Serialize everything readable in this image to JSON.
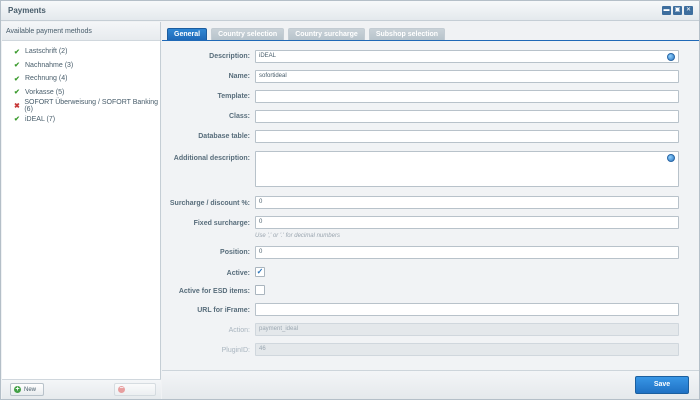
{
  "window": {
    "title": "Payments",
    "controls": [
      "minimize",
      "maximize",
      "close"
    ]
  },
  "sidebar": {
    "heading": "Available payment methods",
    "items": [
      {
        "label": "Lastschrift (2)",
        "active": true
      },
      {
        "label": "Nachnahme (3)",
        "active": true
      },
      {
        "label": "Rechnung (4)",
        "active": true
      },
      {
        "label": "Vorkasse (5)",
        "active": true
      },
      {
        "label": "SOFORT Überweisung / SOFORT Banking (6)",
        "active": false
      },
      {
        "label": "iDEAL (7)",
        "active": true
      }
    ],
    "new_label": "New",
    "delete_label": ""
  },
  "tabs": [
    {
      "label": "General",
      "active": true
    },
    {
      "label": "Country selection",
      "active": false
    },
    {
      "label": "Country surcharge",
      "active": false
    },
    {
      "label": "Subshop selection",
      "active": false
    }
  ],
  "form": {
    "description_label": "Description:",
    "description_value": "iDEAL",
    "name_label": "Name:",
    "name_value": "sofortideal",
    "template_label": "Template:",
    "template_value": "",
    "class_label": "Class:",
    "class_value": "",
    "database_table_label": "Database table:",
    "database_table_value": "",
    "additional_description_label": "Additional description:",
    "additional_description_value": "",
    "surcharge_label": "Surcharge / discount %:",
    "surcharge_value": "0",
    "fixed_surcharge_label": "Fixed surcharge:",
    "fixed_surcharge_value": "0",
    "fixed_surcharge_hint": "Use ',' or '.' for decimal numbers",
    "position_label": "Position:",
    "position_value": "0",
    "active_label": "Active:",
    "active_checked": true,
    "esd_label": "Active for ESD items:",
    "esd_checked": false,
    "iframe_label": "URL for iFrame:",
    "iframe_value": "",
    "action_label": "Action:",
    "action_value": "payment_ideal",
    "plugin_id_label": "PluginID:",
    "plugin_id_value": "46"
  },
  "footer": {
    "save_label": "Save"
  }
}
